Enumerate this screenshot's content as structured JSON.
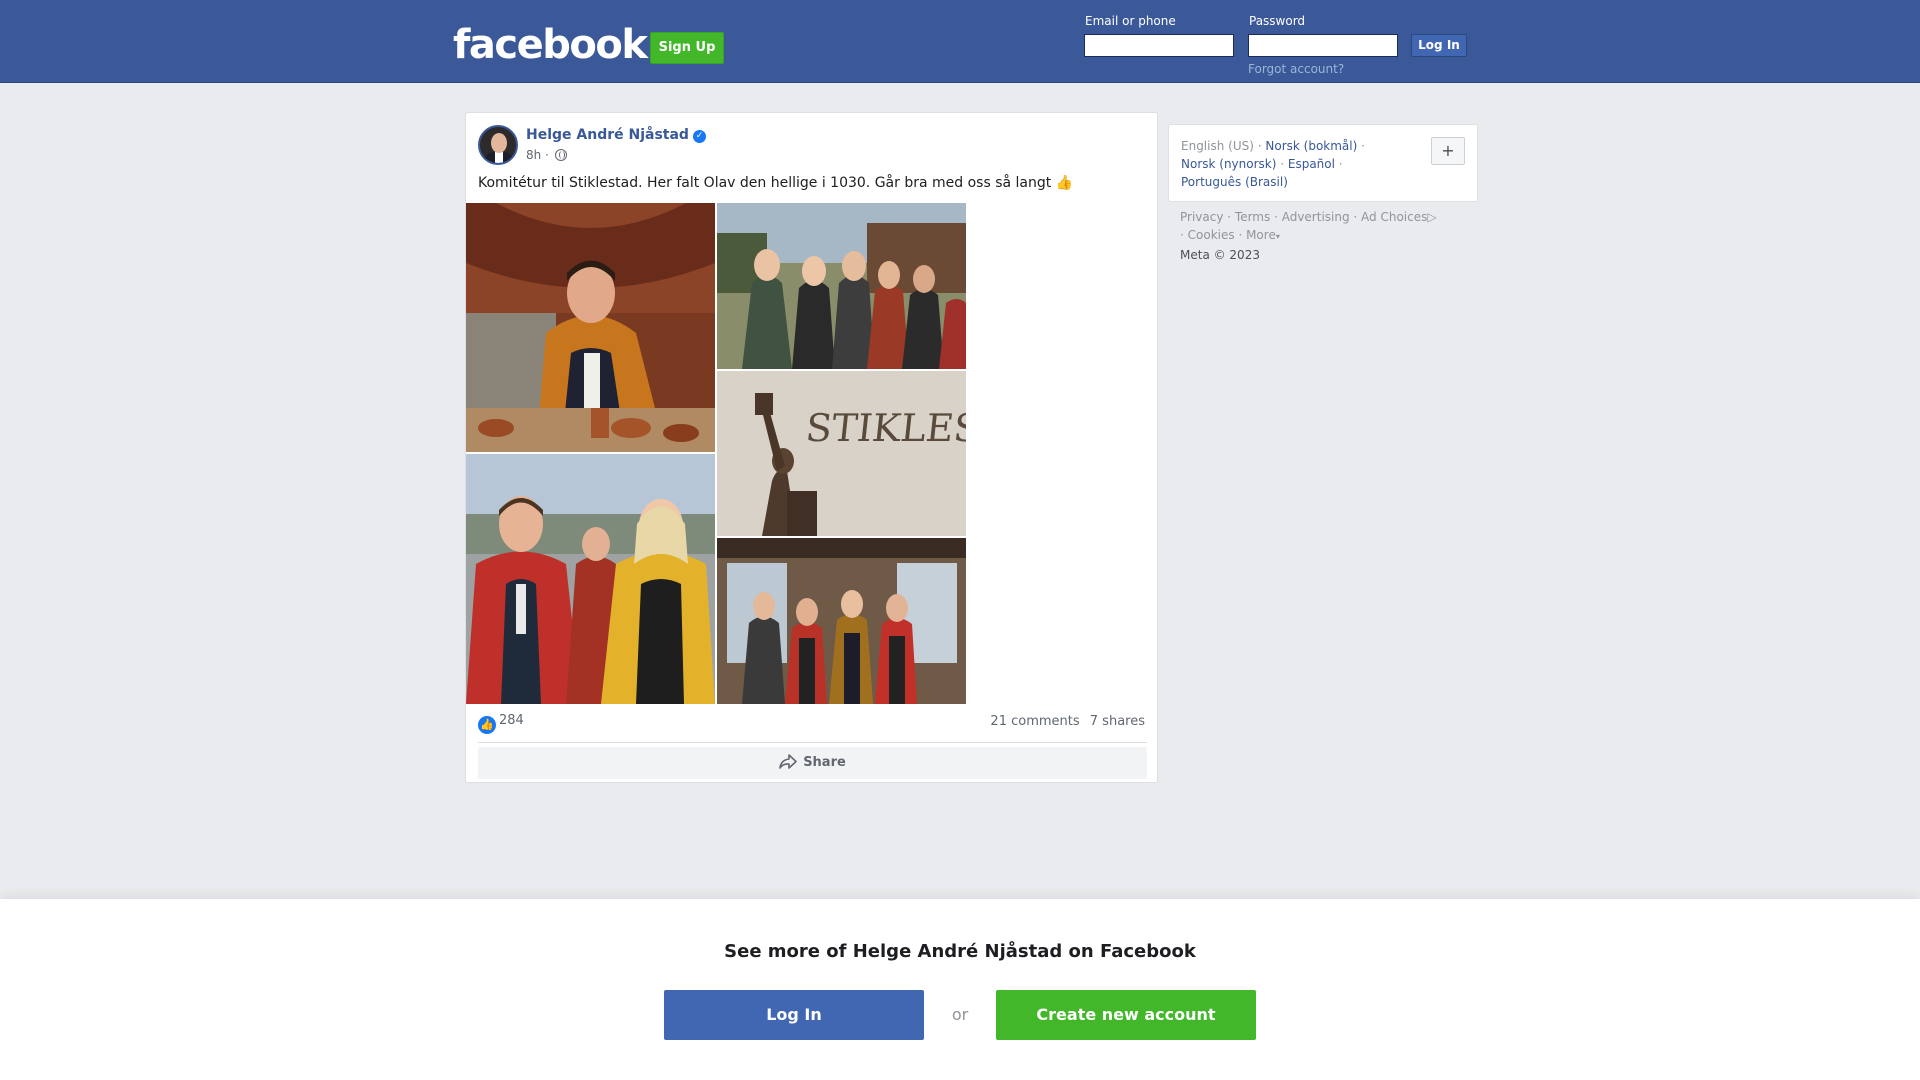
{
  "header": {
    "logo": "facebook",
    "signup_label": "Sign Up",
    "email_label": "Email or phone",
    "password_label": "Password",
    "login_label": "Log In",
    "forgot_label": "Forgot account?"
  },
  "post": {
    "author": "Helge André Njåstad",
    "verified_icon": "✓",
    "time": "8h ·",
    "audience_icon": "globe-icon",
    "text": "Komitétur til Stiklestad. Her falt Olav den hellige i 1030. Går bra med oss så langt 👍",
    "statue_text": "STIKLESTAD",
    "like_icon": "👍",
    "like_count": "284",
    "comments": "21 comments",
    "shares": "7 shares",
    "share_label": "Share"
  },
  "sidebar": {
    "current_language": "English (US)",
    "languages": [
      "Norsk (bokmål)",
      "Norsk (nynorsk)",
      "Español",
      "Português (Brasil)"
    ],
    "add_language_label": "+",
    "footer_links": [
      "Privacy",
      "Terms",
      "Advertising",
      "Ad Choices",
      "Cookies",
      "More"
    ],
    "copyright": "Meta © 2023"
  },
  "banner": {
    "title": "See more of Helge André Njåstad on Facebook",
    "login_label": "Log In",
    "or_label": "or",
    "create_label": "Create new account"
  },
  "colors": {
    "brand": "#3b5998",
    "button_blue": "#4267b2",
    "green": "#42b72a",
    "link": "#385898",
    "background": "#e9ebee"
  }
}
